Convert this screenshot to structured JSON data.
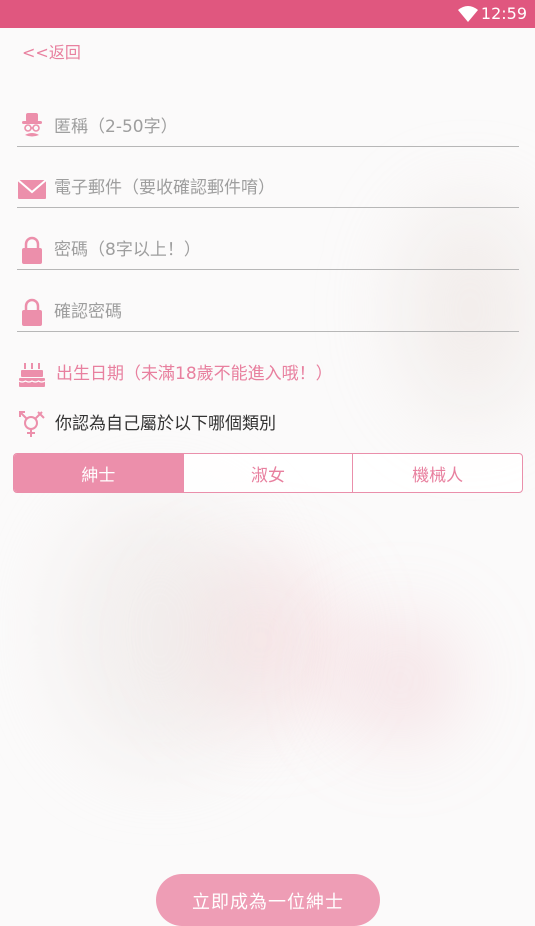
{
  "status_bar": {
    "time": "12:59",
    "icons": [
      "wifi-icon"
    ]
  },
  "nav": {
    "back_label": "<<返回"
  },
  "form": {
    "nickname": {
      "placeholder": "匿稱（2-50字）",
      "value": "",
      "icon": "gentleman-icon"
    },
    "email": {
      "placeholder": "電子郵件（要收確認郵件唷）",
      "value": "",
      "icon": "envelope-icon"
    },
    "password": {
      "placeholder": "密碼（8字以上！）",
      "value": "",
      "icon": "lock-icon"
    },
    "confirm_password": {
      "placeholder": "確認密碼",
      "value": "",
      "icon": "lock-icon"
    },
    "birthdate": {
      "label": "出生日期（未滿18歲不能進入哦！）",
      "icon": "cake-icon"
    },
    "gender_question": {
      "label": "你認為自己屬於以下哪個類別",
      "icon": "gender-icon"
    },
    "gender_options": [
      {
        "label": "紳士",
        "selected": true
      },
      {
        "label": "淑女",
        "selected": false
      },
      {
        "label": "機械人",
        "selected": false
      }
    ]
  },
  "submit": {
    "label": "立即成為一位紳士"
  },
  "colors": {
    "accent": "#e0577f",
    "pink": "#e8809f",
    "button": "#ee9db5"
  }
}
